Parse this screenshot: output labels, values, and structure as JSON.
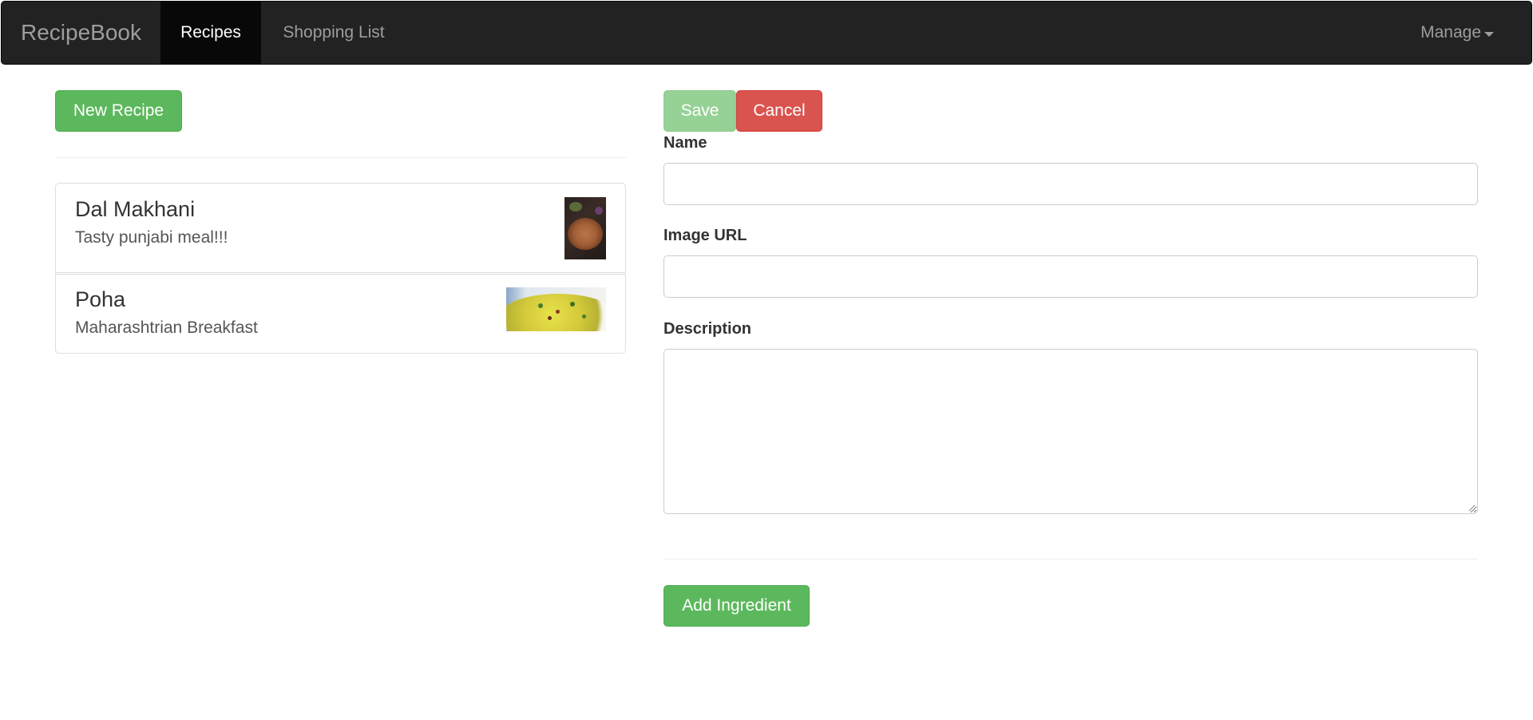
{
  "navbar": {
    "brand": "RecipeBook",
    "items": [
      {
        "label": "Recipes",
        "active": true
      },
      {
        "label": "Shopping List",
        "active": false
      }
    ],
    "manage_label": "Manage"
  },
  "left": {
    "new_recipe_label": "New Recipe",
    "recipes": [
      {
        "name": "Dal Makhani",
        "description": "Tasty punjabi meal!!!",
        "image_icon": "dal-makhani-photo"
      },
      {
        "name": "Poha",
        "description": "Maharashtrian Breakfast",
        "image_icon": "poha-photo"
      }
    ]
  },
  "form": {
    "save_label": "Save",
    "cancel_label": "Cancel",
    "name_label": "Name",
    "name_value": "",
    "image_url_label": "Image URL",
    "image_url_value": "",
    "description_label": "Description",
    "description_value": "",
    "add_ingredient_label": "Add Ingredient"
  },
  "colors": {
    "navbar_bg": "#222222",
    "navbar_active_bg": "#080808",
    "success": "#5cb85c",
    "success_disabled": "#96d196",
    "danger": "#d9534f"
  }
}
